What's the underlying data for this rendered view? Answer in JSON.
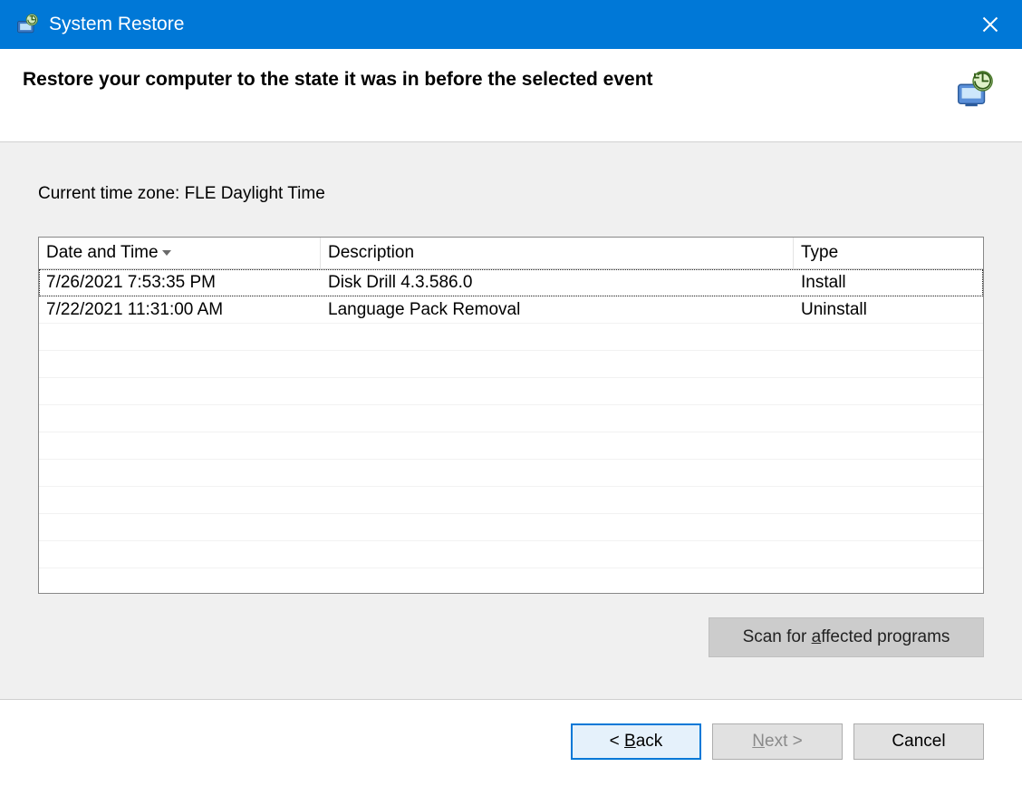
{
  "window": {
    "title": "System Restore"
  },
  "header": {
    "heading": "Restore your computer to the state it was in before the selected event"
  },
  "body": {
    "timezone_label": "Current time zone: FLE Daylight Time",
    "columns": {
      "date": "Date and Time",
      "description": "Description",
      "type": "Type"
    },
    "rows": [
      {
        "date": "7/26/2021 7:53:35 PM",
        "description": "Disk Drill 4.3.586.0",
        "type": "Install"
      },
      {
        "date": "7/22/2021 11:31:00 AM",
        "description": "Language Pack Removal",
        "type": "Uninstall"
      }
    ],
    "scan_button": "Scan for affected programs",
    "scan_mnemonic_index": 9
  },
  "footer": {
    "back_prefix": "< ",
    "back_label": "Back",
    "next_label": "Next",
    "next_suffix": " >",
    "cancel_label": "Cancel"
  }
}
